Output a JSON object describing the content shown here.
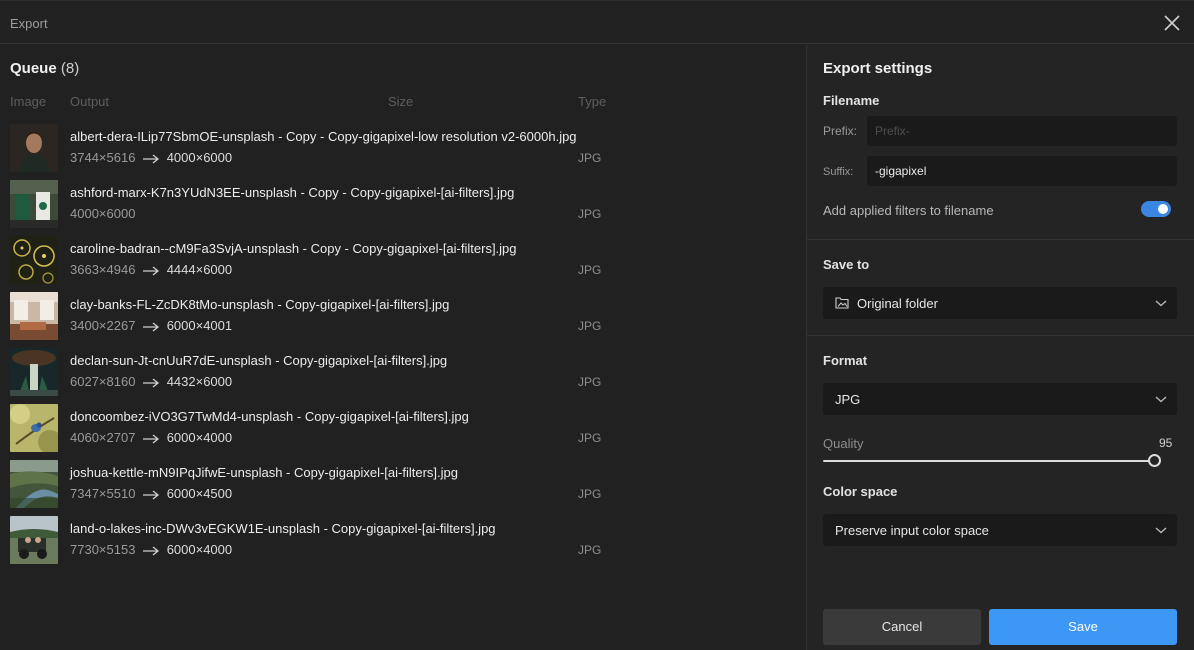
{
  "window": {
    "title": "Export"
  },
  "queue": {
    "title": "Queue",
    "count": "(8)",
    "columns": {
      "image": "Image",
      "output": "Output",
      "size": "Size",
      "type": "Type"
    },
    "items": [
      {
        "filename": "albert-dera-ILip77SbmOE-unsplash - Copy - Copy-gigapixel-low resolution v2-6000h.jpg",
        "input_dims": "3744×5616",
        "output_dims": "4000×6000",
        "type": "JPG"
      },
      {
        "filename": "ashford-marx-K7n3YUdN3EE-unsplash - Copy - Copy-gigapixel-[ai-filters].jpg",
        "input_dims": "4000×6000",
        "output_dims": "",
        "type": "JPG"
      },
      {
        "filename": "caroline-badran--cM9Fa3SvjA-unsplash - Copy - Copy-gigapixel-[ai-filters].jpg",
        "input_dims": "3663×4946",
        "output_dims": "4444×6000",
        "type": "JPG"
      },
      {
        "filename": "clay-banks-FL-ZcDK8tMo-unsplash - Copy-gigapixel-[ai-filters].jpg",
        "input_dims": "3400×2267",
        "output_dims": "6000×4001",
        "type": "JPG"
      },
      {
        "filename": "declan-sun-Jt-cnUuR7dE-unsplash - Copy-gigapixel-[ai-filters].jpg",
        "input_dims": "6027×8160",
        "output_dims": "4432×6000",
        "type": "JPG"
      },
      {
        "filename": "doncoombez-iVO3G7TwMd4-unsplash - Copy-gigapixel-[ai-filters].jpg",
        "input_dims": "4060×2707",
        "output_dims": "6000×4000",
        "type": "JPG"
      },
      {
        "filename": "joshua-kettle-mN9IPqJifwE-unsplash - Copy-gigapixel-[ai-filters].jpg",
        "input_dims": "7347×5510",
        "output_dims": "6000×4500",
        "type": "JPG"
      },
      {
        "filename": "land-o-lakes-inc-DWv3vEGKW1E-unsplash - Copy-gigapixel-[ai-filters].jpg",
        "input_dims": "7730×5153",
        "output_dims": "6000×4000",
        "type": "JPG"
      }
    ]
  },
  "settings": {
    "title": "Export settings",
    "filename": {
      "label": "Filename",
      "prefix_label": "Prefix:",
      "prefix_placeholder": "Prefix-",
      "prefix_value": "",
      "suffix_label": "Suffix:",
      "suffix_value": "-gigapixel",
      "toggle_label": "Add applied filters to filename",
      "toggle_on": true
    },
    "save_to": {
      "label": "Save to",
      "value": "Original folder",
      "icon": "folder-image-icon"
    },
    "format": {
      "label": "Format",
      "value": "JPG"
    },
    "quality": {
      "label": "Quality",
      "value": "95",
      "level": 0.95
    },
    "color_space": {
      "label": "Color space",
      "value": "Preserve input color space"
    },
    "buttons": {
      "cancel": "Cancel",
      "save": "Save"
    }
  },
  "colors": {
    "accent": "#3d97f4",
    "toggle": "#3a86e0",
    "background": "#212121",
    "panel": "#242424"
  }
}
